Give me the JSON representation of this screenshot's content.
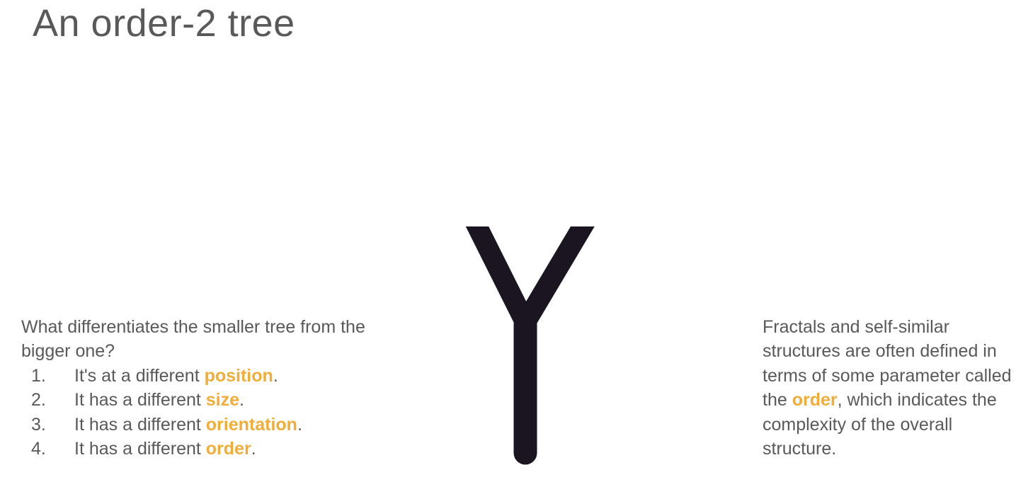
{
  "slide": {
    "title": "An order-2 tree"
  },
  "left": {
    "question": "What differentiates the smaller tree from the bigger one?",
    "items": [
      {
        "number": "1.",
        "prefix": "It's at a different ",
        "keyword": "position",
        "suffix": "."
      },
      {
        "number": "2.",
        "prefix": "It has a different ",
        "keyword": "size",
        "suffix": "."
      },
      {
        "number": "3.",
        "prefix": "It has a different ",
        "keyword": "orientation",
        "suffix": "."
      },
      {
        "number": "4.",
        "prefix": "It has a different ",
        "keyword": "order",
        "suffix": "."
      }
    ]
  },
  "right": {
    "text_before": "Fractals and self-similar structures are often defined in terms of some parameter called the ",
    "keyword": "order",
    "text_after": ", which indicates the complexity of the overall structure."
  },
  "colors": {
    "text": "#595959",
    "highlight": "#f0ad38",
    "tree": "#1a1520"
  },
  "tree_image": {
    "kind": "tree-figure"
  }
}
